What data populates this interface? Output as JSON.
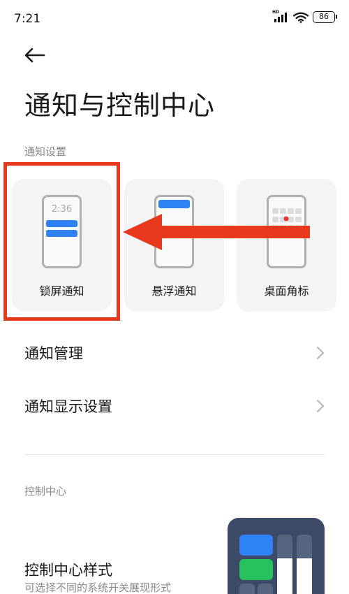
{
  "status_bar": {
    "time": "7:21",
    "hd_label": "HD",
    "battery": "86"
  },
  "header": {
    "title": "通知与控制中心"
  },
  "notification_section": {
    "label": "通知设置",
    "cards": [
      {
        "label": "锁屏通知",
        "preview_time": "2:36"
      },
      {
        "label": "悬浮通知"
      },
      {
        "label": "桌面角标"
      }
    ]
  },
  "list": {
    "items": [
      {
        "label": "通知管理"
      },
      {
        "label": "通知显示设置"
      }
    ]
  },
  "control_center": {
    "label": "控制中心",
    "style_title": "控制中心样式",
    "style_subtitle": "可选择不同的系统开关展现形式"
  },
  "colors": {
    "accent_blue": "#2f82f4",
    "annotation_red": "#e8391f",
    "badge_red": "#e53935",
    "tile_green": "#27c15e"
  }
}
